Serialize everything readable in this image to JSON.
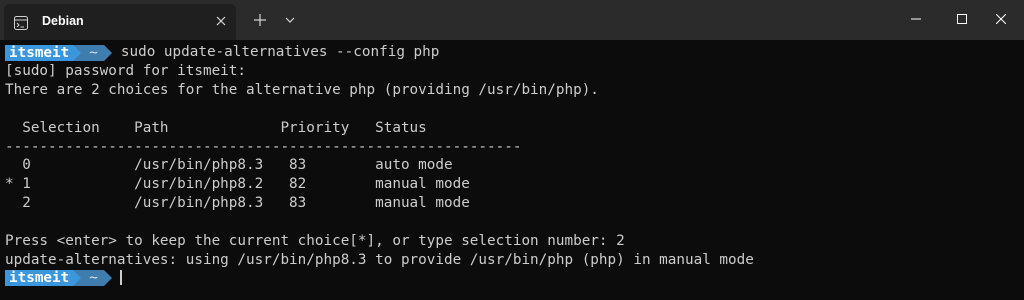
{
  "window": {
    "tab_title": "Debian",
    "tab_icon": "terminal-icon",
    "colors": {
      "titlebar": "#2b2b2b",
      "tab": "#1f1f1f",
      "background": "#0c0c0c",
      "prompt_user_bg": "#3a96dd",
      "prompt_dir_bg": "#3e7dae"
    }
  },
  "prompt": {
    "user": "itsmeit",
    "dir": "~"
  },
  "terminal": {
    "command": "sudo update-alternatives --config php",
    "lines": [
      "[sudo] password for itsmeit:",
      "There are 2 choices for the alternative php (providing /usr/bin/php).",
      "",
      "  Selection    Path             Priority   Status",
      "------------------------------------------------------------",
      "  0            /usr/bin/php8.3   83        auto mode",
      "* 1            /usr/bin/php8.2   82        manual mode",
      "  2            /usr/bin/php8.3   83        manual mode",
      "",
      "Press <enter> to keep the current choice[*], or type selection number: 2",
      "update-alternatives: using /usr/bin/php8.3 to provide /usr/bin/php (php) in manual mode"
    ]
  }
}
